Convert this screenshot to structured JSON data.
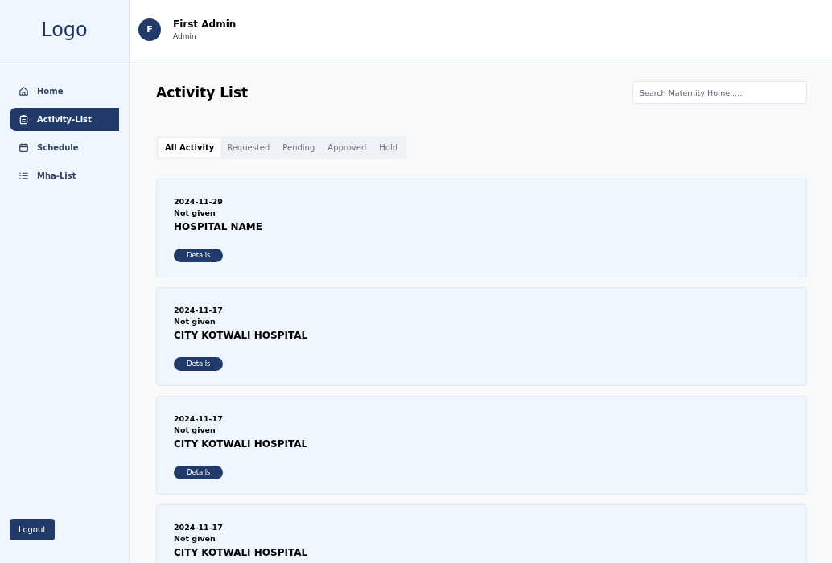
{
  "logo": "Logo",
  "user": {
    "initial": "F",
    "name": "First Admin",
    "role": "Admin"
  },
  "sidebar": {
    "items": [
      {
        "label": "Home",
        "kind": "home",
        "selected": false
      },
      {
        "label": "Activity-List",
        "kind": "clipboard",
        "selected": true
      },
      {
        "label": "Schedule",
        "kind": "calendar",
        "selected": false
      },
      {
        "label": "Mha-List",
        "kind": "list",
        "selected": false
      }
    ],
    "logout": "Logout"
  },
  "page_title": "Activity List",
  "search": {
    "placeholder": "Search Maternity Home....."
  },
  "tabs": [
    {
      "label": "All Activity",
      "selected": true
    },
    {
      "label": "Requested",
      "selected": false
    },
    {
      "label": "Pending",
      "selected": false
    },
    {
      "label": "Approved",
      "selected": false
    },
    {
      "label": "Hold",
      "selected": false
    }
  ],
  "activities": [
    {
      "date": "2024-11-29",
      "note": "Not given",
      "hospital": "HOSPITAL NAME",
      "button": "Details"
    },
    {
      "date": "2024-11-17",
      "note": "Not given",
      "hospital": "CITY KOTWALI HOSPITAL",
      "button": "Details"
    },
    {
      "date": "2024-11-17",
      "note": "Not given",
      "hospital": "CITY KOTWALI HOSPITAL",
      "button": "Details"
    },
    {
      "date": "2024-11-17",
      "note": "Not given",
      "hospital": "CITY KOTWALI HOSPITAL"
    }
  ]
}
